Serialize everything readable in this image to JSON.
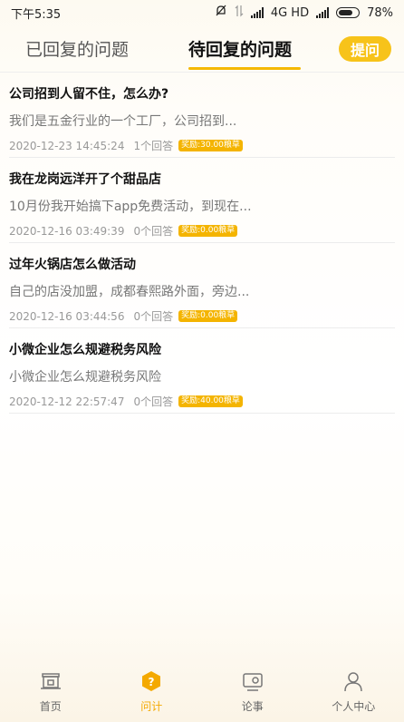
{
  "status_bar": {
    "time": "下午5:35",
    "network": "4G HD",
    "battery": "78%",
    "battery_level": 0.78
  },
  "header": {
    "tabs": [
      {
        "label": "已回复的问题",
        "active": false
      },
      {
        "label": "待回复的问题",
        "active": true
      }
    ],
    "ask_button": "提问"
  },
  "questions": [
    {
      "title": "公司招到人留不住，怎么办?",
      "desc": "我们是五金行业的一个工厂，公司招到...",
      "time": "2020-12-23 14:45:24",
      "answers": "1个回答",
      "reward": "奖励:30.00粮草"
    },
    {
      "title": "我在龙岗远洋开了个甜品店",
      "desc": "10月份我开始搞下app免费活动，到现在...",
      "time": "2020-12-16 03:49:39",
      "answers": "0个回答",
      "reward": "奖励:0.00粮草"
    },
    {
      "title": "过年火锅店怎么做活动",
      "desc": "自己的店没加盟，成都春熙路外面，旁边...",
      "time": "2020-12-16 03:44:56",
      "answers": "0个回答",
      "reward": "奖励:0.00粮草"
    },
    {
      "title": "小微企业怎么规避税务风险",
      "desc": "小微企业怎么规避税务风险",
      "time": "2020-12-12 22:57:47",
      "answers": "0个回答",
      "reward": "奖励:40.00粮草"
    }
  ],
  "bottom_nav": [
    {
      "label": "首页",
      "icon": "home-icon",
      "active": false
    },
    {
      "label": "问计",
      "icon": "question-icon",
      "active": true
    },
    {
      "label": "论事",
      "icon": "discuss-icon",
      "active": false
    },
    {
      "label": "个人中心",
      "icon": "person-icon",
      "active": false
    }
  ],
  "colors": {
    "accent": "#f5b800",
    "reward_badge": "#f4b400",
    "active_nav": "#f4a900"
  }
}
